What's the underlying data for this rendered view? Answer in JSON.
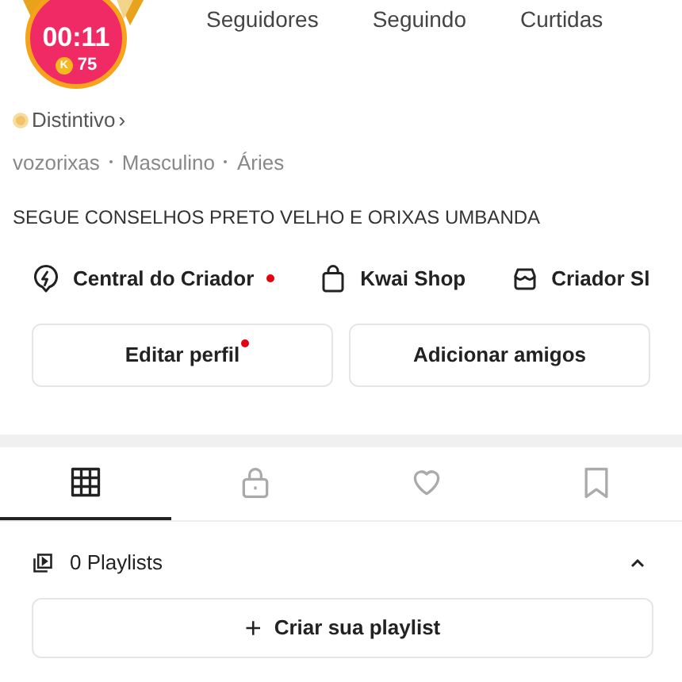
{
  "avatar": {
    "timer": "00:11",
    "coin_symbol": "K",
    "coins": "75"
  },
  "stats": [
    {
      "label": "Seguidores"
    },
    {
      "label": "Seguindo"
    },
    {
      "label": "Curtidas"
    }
  ],
  "badge": {
    "label": "Distintivo",
    "chevron": "›"
  },
  "info": [
    "vozorixas",
    "Masculino",
    "Áries"
  ],
  "bio": "SEGUE CONSELHOS PRETO VELHO E ORIXAS UMBANDA",
  "links": [
    {
      "kind": "bolt",
      "label": "Central do Criador",
      "dot": true
    },
    {
      "kind": "bag",
      "label": "Kwai Shop",
      "dot": false
    },
    {
      "kind": "store",
      "label": "Criador Sl",
      "dot": false
    }
  ],
  "buttons": [
    {
      "label": "Editar perfil",
      "dot": true
    },
    {
      "label": "Adicionar amigos",
      "dot": false
    }
  ],
  "tabs": [
    {
      "kind": "grid",
      "selected": true
    },
    {
      "kind": "lock",
      "selected": false
    },
    {
      "kind": "heart",
      "selected": false
    },
    {
      "kind": "bookmark",
      "selected": false
    }
  ],
  "playlists": {
    "label": "0 Playlists",
    "expanded": true
  },
  "create_button": {
    "icon": "+",
    "label": "Criar sua playlist"
  }
}
